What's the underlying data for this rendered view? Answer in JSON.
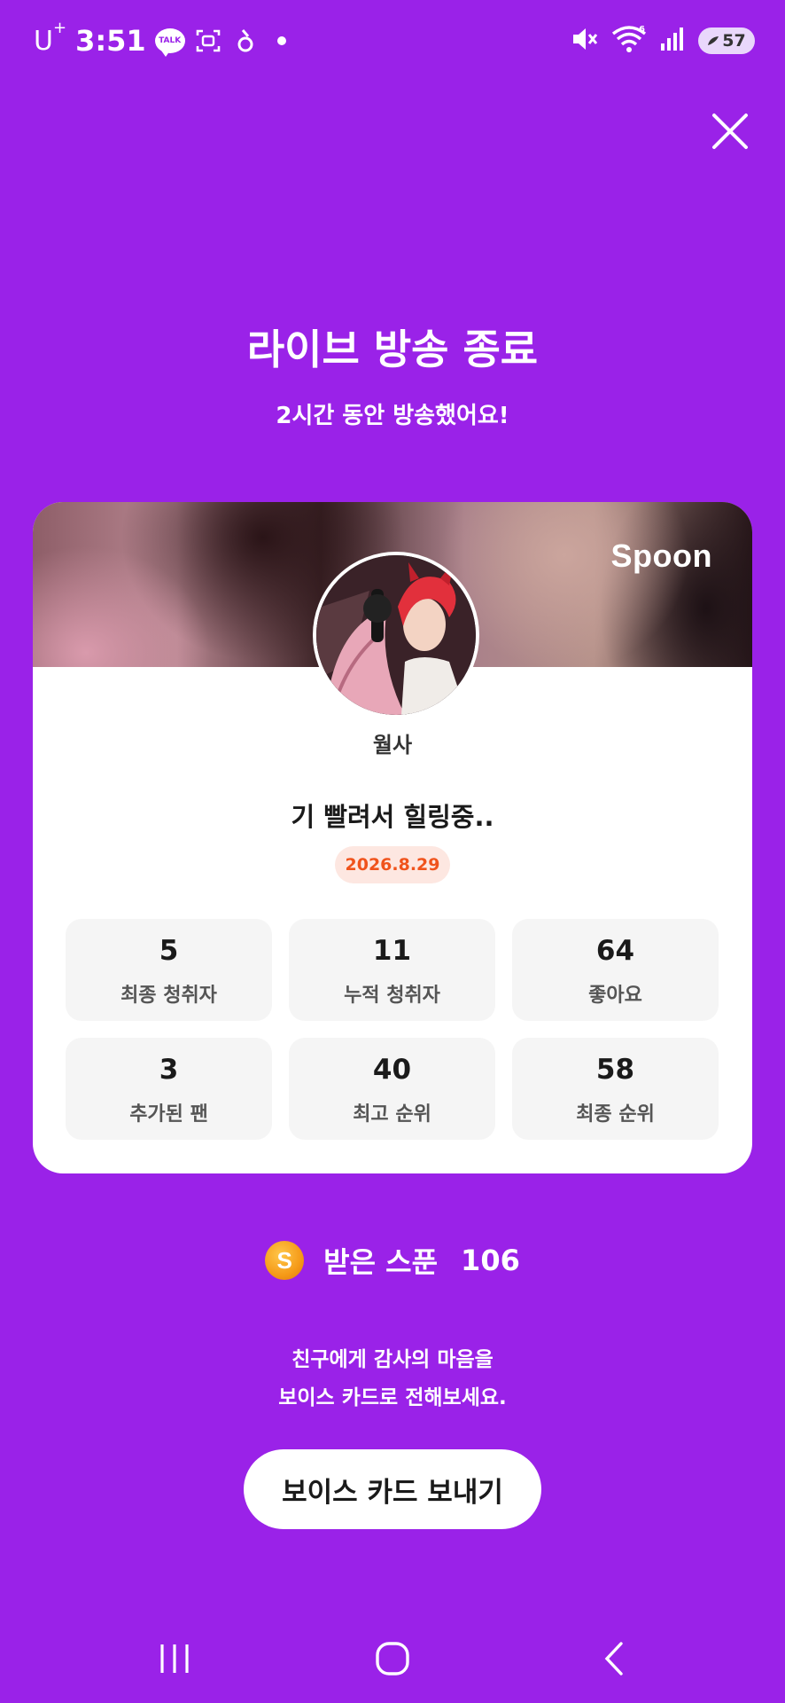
{
  "status_bar": {
    "carrier": "U",
    "carrier_sup": "+",
    "time": "3:51",
    "talk_label": "TALK",
    "battery": "57"
  },
  "header": {
    "title": "라이브 방송 종료",
    "subtitle": "2시간 동안 방송했어요!"
  },
  "card": {
    "brand": "Spoon",
    "nickname": "월사",
    "live_title": "기 빨려서 힐링중..",
    "date": "2026.8.29",
    "stats": [
      {
        "value": "5",
        "label": "최종 청취자"
      },
      {
        "value": "11",
        "label": "누적 청취자"
      },
      {
        "value": "64",
        "label": "좋아요"
      },
      {
        "value": "3",
        "label": "추가된 팬"
      },
      {
        "value": "40",
        "label": "최고 순위"
      },
      {
        "value": "58",
        "label": "최종 순위"
      }
    ]
  },
  "spoons": {
    "icon_letter": "S",
    "label": "받은 스푼",
    "count": "106"
  },
  "thanks": {
    "line1": "친구에게 감사의 마음을",
    "line2": "보이스 카드로 전해보세요."
  },
  "actions": {
    "voice_card_button": "보이스 카드 보내기"
  },
  "colors": {
    "background": "#9a22e8",
    "date_text": "#f0531c",
    "date_bg": "#fde7e1",
    "spoon_icon": "#f59a18"
  },
  "icons": [
    "close-icon",
    "kakaotalk-icon",
    "screenshot-icon",
    "notification-icon",
    "mute-icon",
    "wifi-icon",
    "signal-icon",
    "battery-icon",
    "recent-apps-icon",
    "home-icon",
    "back-icon"
  ]
}
